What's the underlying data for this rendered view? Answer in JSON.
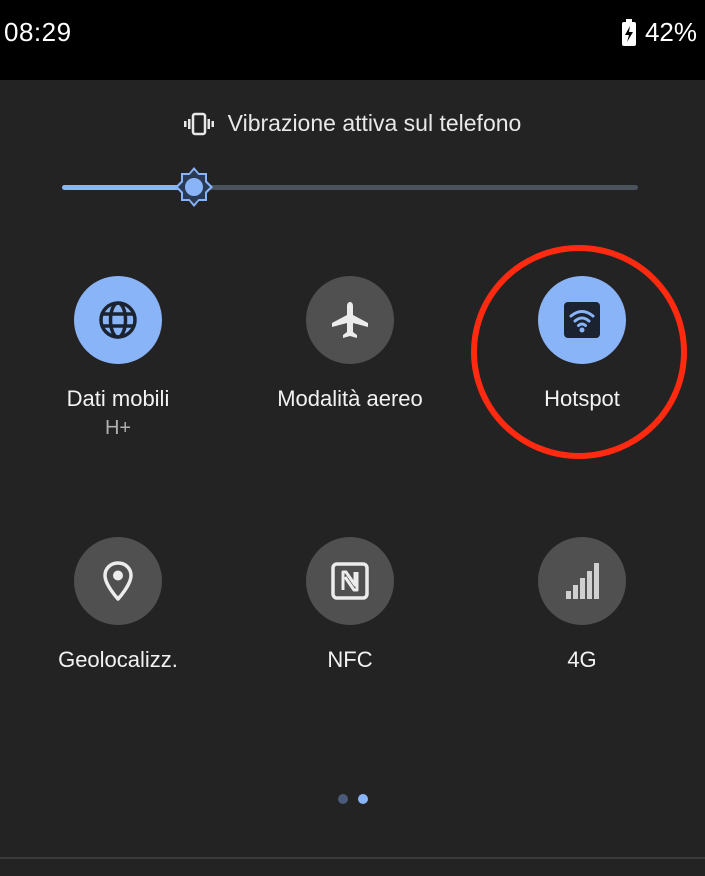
{
  "status_bar": {
    "time": "08:29",
    "battery_percent": "42%",
    "battery_icon": "battery-charging-icon"
  },
  "quick_settings": {
    "vibration_text": "Vibrazione attiva sul telefono",
    "vibration_icon": "vibrate-icon",
    "brightness": {
      "level": 0.23,
      "icon": "brightness-icon"
    },
    "tiles": [
      {
        "label": "Dati mobili",
        "sublabel": "H+",
        "state": "on",
        "icon": "globe-icon"
      },
      {
        "label": "Modalità aereo",
        "sublabel": "",
        "state": "off",
        "icon": "airplane-icon"
      },
      {
        "label": "Hotspot",
        "sublabel": "",
        "state": "on",
        "icon": "hotspot-icon",
        "highlighted": true
      },
      {
        "label": "Geolocalizz.",
        "sublabel": "",
        "state": "off",
        "icon": "location-pin-icon"
      },
      {
        "label": "NFC",
        "sublabel": "",
        "state": "off",
        "icon": "nfc-icon"
      },
      {
        "label": "4G",
        "sublabel": "",
        "state": "off",
        "icon": "signal-bars-icon"
      }
    ],
    "pages": {
      "count": 2,
      "current": 2
    }
  },
  "colors": {
    "accent": "#8ab4f8",
    "tile_off": "#505050",
    "panel_background": "#232323",
    "highlight_ring": "#ff2a10"
  }
}
